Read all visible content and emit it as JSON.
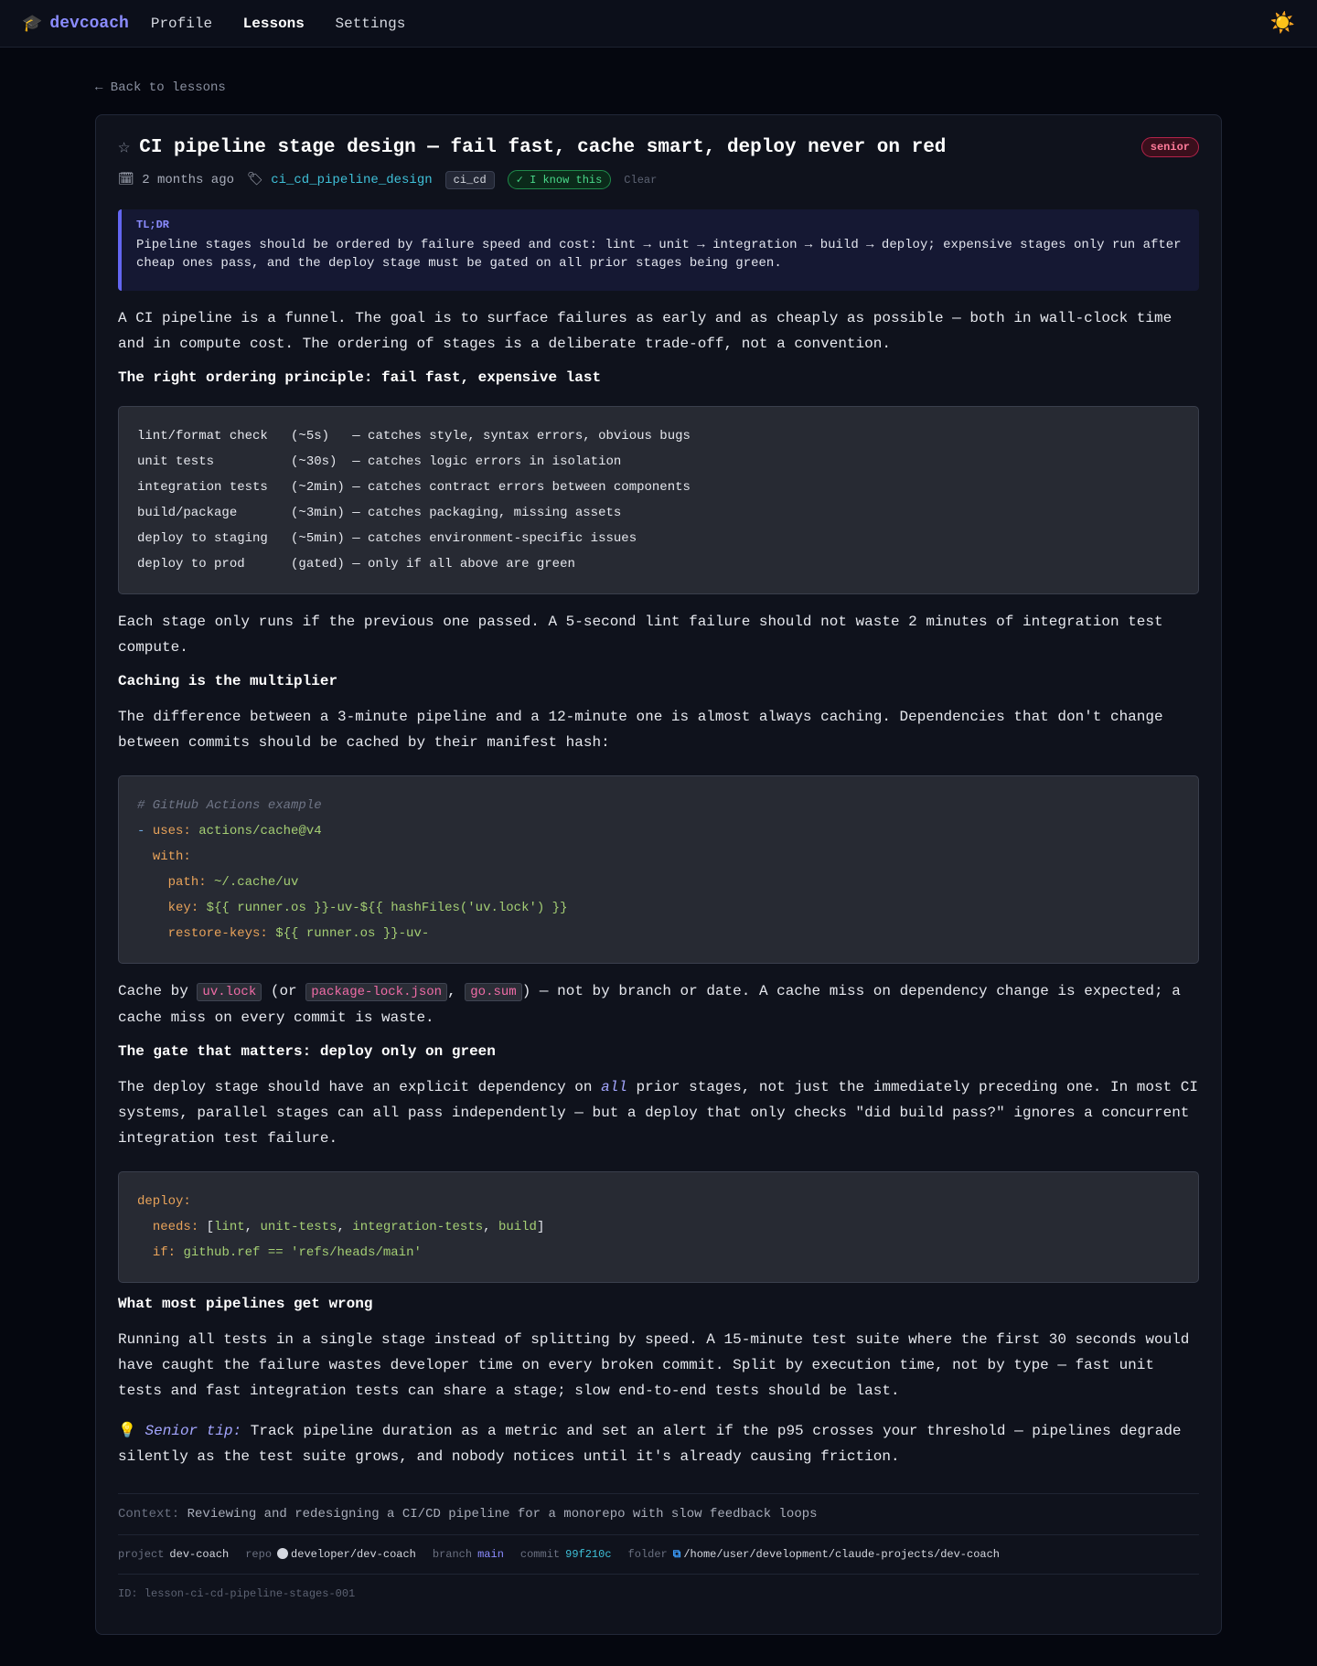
{
  "nav": {
    "brand": "devcoach",
    "items": [
      "Profile",
      "Lessons",
      "Settings"
    ],
    "active": "Lessons"
  },
  "back_label": "← Back to lessons",
  "lesson": {
    "title": "CI pipeline stage design — fail fast, cache smart, deploy never on red",
    "level": "senior",
    "age": "2 months ago",
    "topic_link": "ci_cd_pipeline_design",
    "category": "ci_cd",
    "know_label": "✓ I know this",
    "clear_label": "Clear",
    "tldr_label": "TL;DR",
    "tldr": "Pipeline stages should be ordered by failure speed and cost: lint → unit → integration → build → deploy; expensive stages only run after cheap ones pass, and the deploy stage must be gated on all prior stages being green.",
    "p1": "A CI pipeline is a funnel. The goal is to surface failures as early and as cheaply as possible — both in wall-clock time and in compute cost. The ordering of stages is a deliberate trade-off, not a convention.",
    "h1": "The right ordering principle: fail fast, expensive last",
    "code1": [
      "lint/format check   (~5s)   — catches style, syntax errors, obvious bugs",
      "unit tests          (~30s)  — catches logic errors in isolation",
      "integration tests   (~2min) — catches contract errors between components",
      "build/package       (~3min) — catches packaging, missing assets",
      "deploy to staging   (~5min) — catches environment-specific issues",
      "deploy to prod      (gated) — only if all above are green"
    ],
    "p2": "Each stage only runs if the previous one passed. A 5-second lint failure should not waste 2 minutes of integration test compute.",
    "h2": "Caching is the multiplier",
    "p3": "The difference between a 3-minute pipeline and a 12-minute one is almost always caching. Dependencies that don't change between commits should be cached by their manifest hash:",
    "code2": {
      "comment": "# GitHub Actions example",
      "uses_key": "uses:",
      "uses_val": "actions/cache@v4",
      "with_key": "with:",
      "path_key": "path:",
      "path_val": "~/.cache/uv",
      "key_key": "key:",
      "key_val": "${{ runner.os }}-uv-${{ hashFiles('uv.lock') }}",
      "restore_key": "restore-keys:",
      "restore_val": "${{ runner.os }}-uv-"
    },
    "p4": {
      "a": "Cache by ",
      "code_a": "uv.lock",
      "b": " (or ",
      "code_b": "package-lock.json",
      "c": ", ",
      "code_c": "go.sum",
      "d": ") — not by branch or date. A cache miss on dependency change is expected; a cache miss on every commit is waste."
    },
    "h3": "The gate that matters: deploy only on green",
    "p5": {
      "a": "The deploy stage should have an explicit dependency on ",
      "em": "all",
      "b": " prior stages, not just the immediately preceding one. In most CI systems, parallel stages can all pass independently — but a deploy that only checks \"did build pass?\" ignores a concurrent integration test failure."
    },
    "code3": {
      "deploy_key": "deploy:",
      "needs_key": "needs:",
      "needs_items": [
        "lint",
        "unit-tests",
        "integration-tests",
        "build"
      ],
      "if_key": "if:",
      "if_val": "github.ref == 'refs/heads/main'"
    },
    "h4": "What most pipelines get wrong",
    "p6": "Running all tests in a single stage instead of splitting by speed. A 15-minute test suite where the first 30 seconds would have caught the failure wastes developer time on every broken commit. Split by execution time, not by type — fast unit tests and fast integration tests can share a stage; slow end-to-end tests should be last.",
    "tip": {
      "icon": "💡",
      "label": "Senior tip:",
      "text": " Track pipeline duration as a metric and set an alert if the p95 crosses your threshold — pipelines degrade silently as the test suite grows, and nobody notices until it's already causing friction."
    },
    "context_label": "Context:",
    "context": " Reviewing and redesigning a CI/CD pipeline for a monorepo with slow feedback loops",
    "meta": {
      "project_label": "project",
      "project": "dev-coach",
      "repo_label": "repo",
      "repo": "developer/dev-coach",
      "branch_label": "branch",
      "branch": "main",
      "commit_label": "commit",
      "commit": "99f210c",
      "folder_label": "folder",
      "folder": "/home/user/development/claude-projects/dev-coach"
    },
    "id": "ID: lesson-ci-cd-pipeline-stages-001"
  }
}
